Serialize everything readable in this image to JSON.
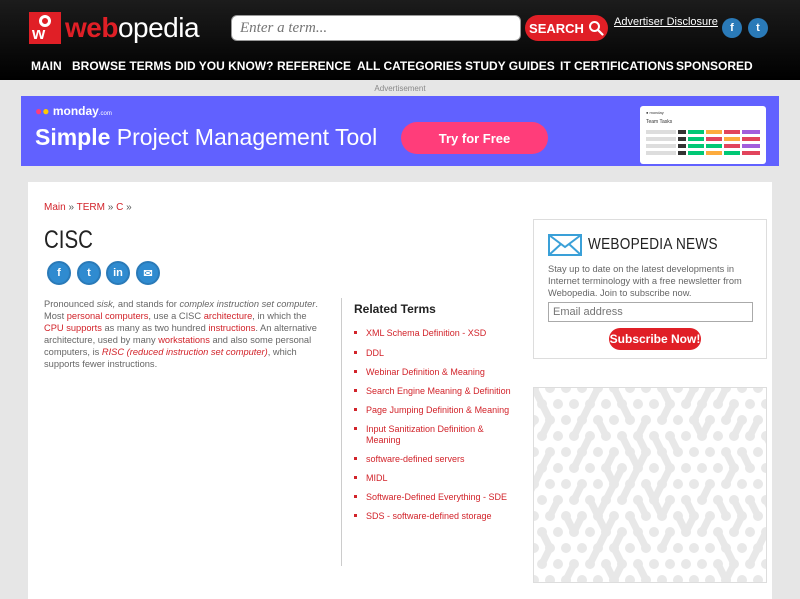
{
  "header": {
    "logo_part1": "web",
    "logo_part2": "opedia",
    "logo_mark": "w",
    "search_placeholder": "Enter a term...",
    "search_label": "SEARCH",
    "advertiser_disclosure": "Advertiser Disclosure",
    "social": [
      {
        "icon": "facebook-icon",
        "glyph": "f"
      },
      {
        "icon": "twitter-icon",
        "glyph": "t"
      }
    ]
  },
  "nav": [
    "MAIN",
    "BROWSE TERMS",
    "DID YOU KNOW?",
    "REFERENCE",
    "ALL CATEGORIES",
    "STUDY GUIDES",
    "IT CERTIFICATIONS",
    "SPONSORED"
  ],
  "ad": {
    "label": "Advertisement",
    "brand": "monday",
    "brand_suffix": ".com",
    "headline_bold": "Simple",
    "headline_rest": " Project Management Tool",
    "cta": "Try for Free",
    "preview_title": "Team Tasks"
  },
  "breadcrumb": [
    "Main",
    "TERM",
    "C"
  ],
  "breadcrumb_sep": "»",
  "title": "CISC",
  "share": [
    {
      "name": "facebook-share-icon",
      "glyph": "f"
    },
    {
      "name": "twitter-share-icon",
      "glyph": "t"
    },
    {
      "name": "linkedin-share-icon",
      "glyph": "in"
    },
    {
      "name": "email-share-icon",
      "glyph": "✉"
    }
  ],
  "definition": {
    "p1": "Pronounced ",
    "p1_italic": "sisk,",
    "p2": " and stands for ",
    "p2_italic": "complex instruction set computer",
    "p3": ". Most ",
    "link1": "personal computers",
    "p4": ", use a CISC ",
    "link2": "architecture",
    "p5": ", in which the ",
    "link3": "CPU supports",
    "p6": " as many as two hundred ",
    "link4": "instructions",
    "p7": ". An alternative architecture, used by many ",
    "link5": "workstations",
    "p8": " and also some personal computers, is ",
    "link6": "RISC (reduced instruction set computer)",
    "p9": ", which supports fewer instructions."
  },
  "related": {
    "title": "Related Terms",
    "items": [
      "XML Schema Definition - XSD",
      "DDL",
      "Webinar Definition & Meaning",
      "Search Engine Meaning & Definition",
      "Page Jumping Definition & Meaning",
      "Input Sanitization Definition & Meaning",
      "software-defined servers",
      "MIDL",
      "Software-Defined Everything - SDE",
      "SDS - software-defined storage"
    ]
  },
  "news": {
    "title": "WEBOPEDIA NEWS",
    "text": "Stay up to date on the latest developments in Internet terminology with a free newsletter from Webopedia. Join to subscribe now.",
    "input_placeholder": "Email address",
    "button": "Subscribe Now!"
  },
  "colors": {
    "brand_red": "#e01f26",
    "link_red": "#d2232a",
    "ad_purple": "#6161ff",
    "cta_pink": "#ff3d7a"
  }
}
